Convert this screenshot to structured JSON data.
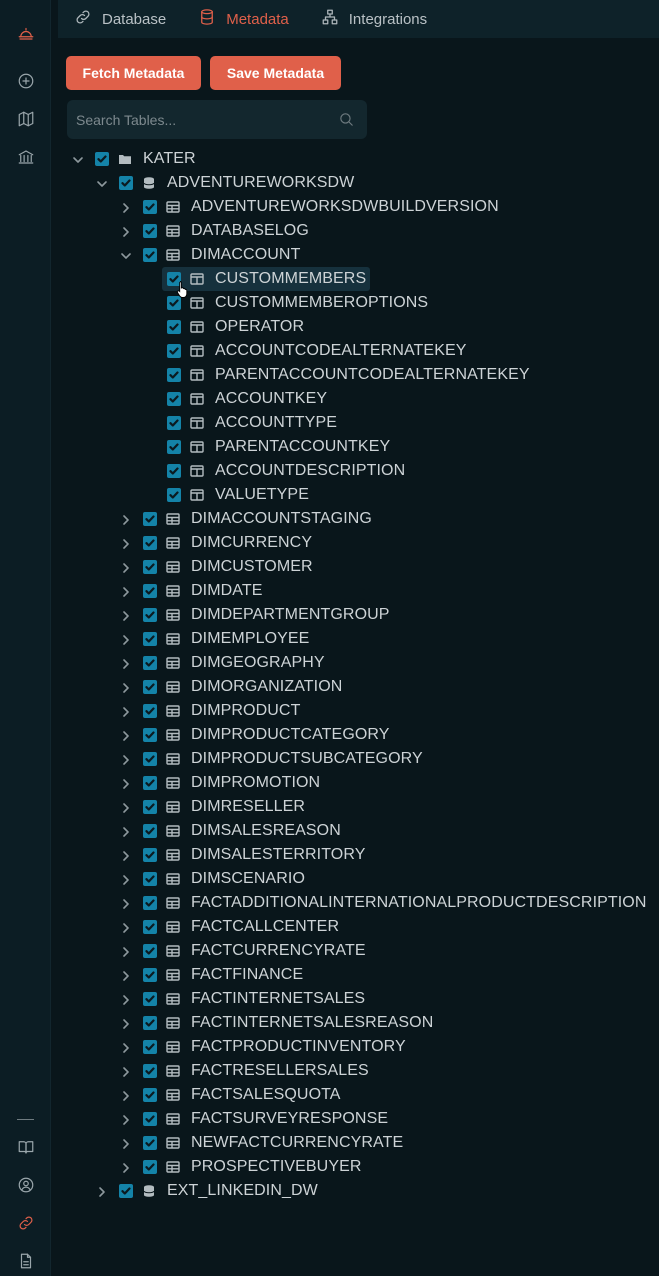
{
  "tabs": [
    {
      "label": "Database",
      "icon": "link-icon",
      "active": false
    },
    {
      "label": "Metadata",
      "icon": "database-icon",
      "active": true
    },
    {
      "label": "Integrations",
      "icon": "network-icon",
      "active": false
    }
  ],
  "buttons": {
    "fetch_label": "Fetch Metadata",
    "save_label": "Save Metadata"
  },
  "search": {
    "placeholder": "Search Tables...",
    "value": ""
  },
  "colors": {
    "accent": "#e0604a",
    "checkbox": "#1483a8",
    "background": "#09161b"
  },
  "tree": {
    "root": "KATER",
    "database": "ADVENTUREWORKSDW",
    "tables_before": [
      "ADVENTUREWORKSDWBUILDVERSION",
      "DATABASELOG"
    ],
    "expanded_table": "DIMACCOUNT",
    "columns": [
      "CUSTOMMEMBERS",
      "CUSTOMMEMBEROPTIONS",
      "OPERATOR",
      "ACCOUNTCODEALTERNATEKEY",
      "PARENTACCOUNTCODEALTERNATEKEY",
      "ACCOUNTKEY",
      "ACCOUNTTYPE",
      "PARENTACCOUNTKEY",
      "ACCOUNTDESCRIPTION",
      "VALUETYPE"
    ],
    "tables_after": [
      "DIMACCOUNTSTAGING",
      "DIMCURRENCY",
      "DIMCUSTOMER",
      "DIMDATE",
      "DIMDEPARTMENTGROUP",
      "DIMEMPLOYEE",
      "DIMGEOGRAPHY",
      "DIMORGANIZATION",
      "DIMPRODUCT",
      "DIMPRODUCTCATEGORY",
      "DIMPRODUCTSUBCATEGORY",
      "DIMPROMOTION",
      "DIMRESELLER",
      "DIMSALESREASON",
      "DIMSALESTERRITORY",
      "DIMSCENARIO",
      "FACTADDITIONALINTERNATIONALPRODUCTDESCRIPTION",
      "FACTCALLCENTER",
      "FACTCURRENCYRATE",
      "FACTFINANCE",
      "FACTINTERNETSALES",
      "FACTINTERNETSALESREASON",
      "FACTPRODUCTINVENTORY",
      "FACTRESELLERSALES",
      "FACTSALESQUOTA",
      "FACTSURVEYRESPONSE",
      "NEWFACTCURRENCYRATE",
      "PROSPECTIVEBUYER"
    ],
    "other_database": "EXT_LINKEDIN_DW"
  }
}
